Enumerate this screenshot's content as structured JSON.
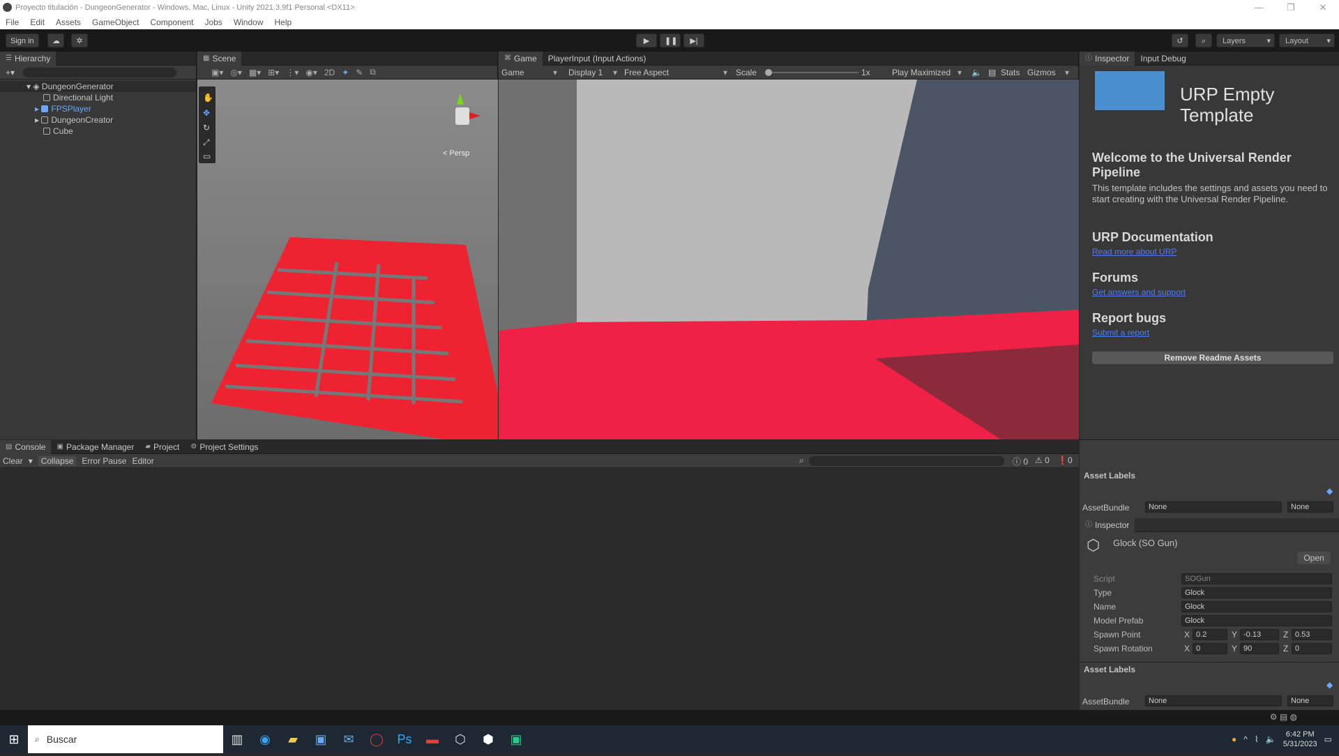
{
  "window": {
    "title": "Proyecto titulación - DungeonGenerator - Windows, Mac, Linux - Unity 2021.3.9f1 Personal <DX11>"
  },
  "menu": [
    "File",
    "Edit",
    "Assets",
    "GameObject",
    "Component",
    "Jobs",
    "Window",
    "Help"
  ],
  "toolbar": {
    "signin": "Sign in",
    "layers": "Layers",
    "layout": "Layout"
  },
  "hierarchy": {
    "tab": "Hierarchy",
    "root": "DungeonGenerator",
    "items": [
      "Directional Light",
      "FPSPlayer",
      "DungeonCreator",
      "Cube"
    ]
  },
  "scene": {
    "tab": "Scene",
    "mode2d": "2D",
    "persp": "< Persp"
  },
  "game": {
    "tab": "Game",
    "tab2": "PlayerInput (Input Actions)",
    "display_mode": "Game",
    "display": "Display 1",
    "aspect": "Free Aspect",
    "scale_label": "Scale",
    "scale_value": "1x",
    "play_mode": "Play Maximized",
    "stats": "Stats",
    "gizmos": "Gizmos"
  },
  "inspector": {
    "tab": "Inspector",
    "tab2": "Input Debug",
    "readme_title": "URP Empty Template",
    "sections": [
      {
        "heading": "Welcome to the Universal Render Pipeline",
        "text": "This template includes the settings and assets you need to start creating with the Universal Render Pipeline."
      },
      {
        "heading": "URP Documentation",
        "link": "Read more about URP"
      },
      {
        "heading": "Forums",
        "link": "Get answers and support"
      },
      {
        "heading": "Report bugs",
        "link": "Submit a report"
      }
    ],
    "remove_button": "Remove Readme Assets",
    "asset_labels": "Asset Labels",
    "assetbundle_label": "AssetBundle",
    "assetbundle_value": "None",
    "assetbundle_variant": "None"
  },
  "inspector2": {
    "tab": "Inspector",
    "object": "Glock (SO Gun)",
    "open_button": "Open",
    "props": {
      "script_label": "Script",
      "script_value": "SOGun",
      "type_label": "Type",
      "type_value": "Glock",
      "name_label": "Name",
      "name_value": "Glock",
      "model_label": "Model Prefab",
      "model_value": "Glock",
      "spawnpoint_label": "Spawn Point",
      "sp_x": "0.2",
      "sp_y": "-0.13",
      "sp_z": "0.53",
      "spawnrot_label": "Spawn Rotation",
      "sr_x": "0",
      "sr_y": "90",
      "sr_z": "0",
      "x": "X",
      "y": "Y",
      "z": "Z"
    },
    "asset_labels": "Asset Labels",
    "assetbundle_label": "AssetBundle",
    "assetbundle_value": "None",
    "assetbundle_variant": "None"
  },
  "console": {
    "tabs": [
      "Console",
      "Package Manager",
      "Project",
      "Project Settings"
    ],
    "clear": "Clear",
    "collapse": "Collapse",
    "error_pause": "Error Pause",
    "editor": "Editor",
    "count_log": "0",
    "count_warn": "0",
    "count_err": "0"
  },
  "taskbar": {
    "search": "Buscar",
    "time": "6:42 PM",
    "date": "5/31/2023"
  },
  "colors": {
    "red": "#f0233a",
    "link": "#4c7efc",
    "dark": "#282828"
  }
}
